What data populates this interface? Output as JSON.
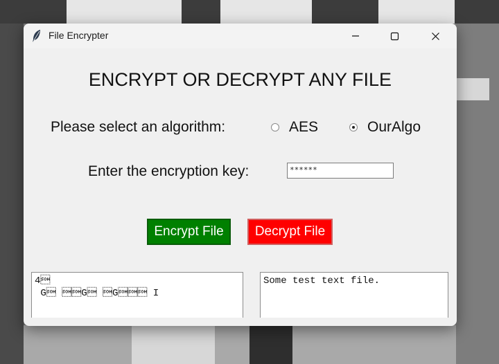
{
  "window": {
    "title": "File Encrypter",
    "app_icon": "feather-icon",
    "controls": [
      "minimize-icon",
      "maximize-icon",
      "close-icon"
    ]
  },
  "main": {
    "heading": "ENCRYPT OR DECRYPT ANY FILE",
    "algorithm_label": "Please select an algorithm:",
    "algorithms": [
      {
        "label": "AES",
        "selected": false
      },
      {
        "label": "OurAlgo",
        "selected": true
      }
    ],
    "key_label": "Enter the encryption key:",
    "key_value": "******",
    "encrypt_button": "Encrypt File",
    "decrypt_button": "Decrypt File",
    "output_text": "4\u0001\n G\u0001 \u0001\u0001G\u0001 \u0001G\u0001\u0001\u0001 I",
    "input_text": "Some test text file."
  },
  "colors": {
    "encrypt_button": "#008000",
    "decrypt_button": "#ff0000",
    "window_background": "#f0f0f0"
  }
}
